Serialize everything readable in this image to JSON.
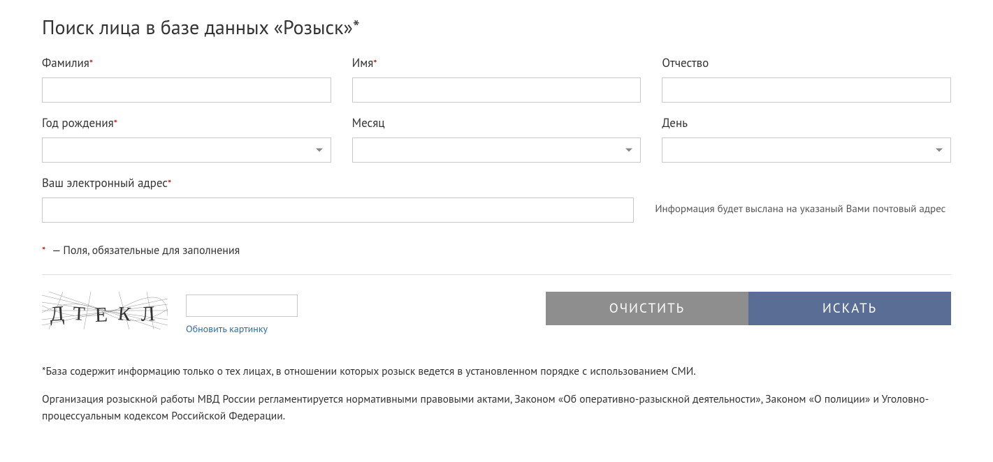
{
  "title": "Поиск лица в базе данных «Розыск»*",
  "fields": {
    "surname": {
      "label": "Фамилия",
      "required": true
    },
    "name": {
      "label": "Имя",
      "required": true
    },
    "patronym": {
      "label": "Отчество",
      "required": false
    },
    "year": {
      "label": "Год рождения",
      "required": true
    },
    "month": {
      "label": "Месяц",
      "required": false
    },
    "day": {
      "label": "День",
      "required": false
    },
    "email": {
      "label": "Ваш электронный адрес",
      "required": true
    }
  },
  "info_note": "Информация будет выслана на указаный Вами почтовый адрес",
  "required_note_dash": " — ",
  "required_note_text": "Поля, обязательные для заполнения",
  "captcha": {
    "image_text": "Д Т Е К Л",
    "refresh_label": "Обновить картинку"
  },
  "buttons": {
    "clear": "очистить",
    "search": "искать"
  },
  "foot1": "*База содержит информацию только о тех лицах, в отношении которых розыск ведется в установленном порядке с использованием СМИ.",
  "foot2": "Организация розыскной работы МВД России регламентируется нормативными правовыми актами, Законом «Об оперативно-разыскной деятельности», Законом «О полиции» и Уголовно-процессуальным кодексом Российской Федерации.",
  "asterisk": "*"
}
